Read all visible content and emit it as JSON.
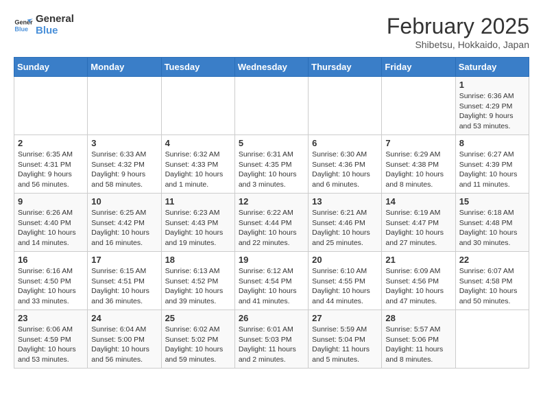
{
  "header": {
    "logo_line1": "General",
    "logo_line2": "Blue",
    "month_year": "February 2025",
    "location": "Shibetsu, Hokkaido, Japan"
  },
  "days_of_week": [
    "Sunday",
    "Monday",
    "Tuesday",
    "Wednesday",
    "Thursday",
    "Friday",
    "Saturday"
  ],
  "weeks": [
    [
      {
        "day": "",
        "info": ""
      },
      {
        "day": "",
        "info": ""
      },
      {
        "day": "",
        "info": ""
      },
      {
        "day": "",
        "info": ""
      },
      {
        "day": "",
        "info": ""
      },
      {
        "day": "",
        "info": ""
      },
      {
        "day": "1",
        "info": "Sunrise: 6:36 AM\nSunset: 4:29 PM\nDaylight: 9 hours and 53 minutes."
      }
    ],
    [
      {
        "day": "2",
        "info": "Sunrise: 6:35 AM\nSunset: 4:31 PM\nDaylight: 9 hours and 56 minutes."
      },
      {
        "day": "3",
        "info": "Sunrise: 6:33 AM\nSunset: 4:32 PM\nDaylight: 9 hours and 58 minutes."
      },
      {
        "day": "4",
        "info": "Sunrise: 6:32 AM\nSunset: 4:33 PM\nDaylight: 10 hours and 1 minute."
      },
      {
        "day": "5",
        "info": "Sunrise: 6:31 AM\nSunset: 4:35 PM\nDaylight: 10 hours and 3 minutes."
      },
      {
        "day": "6",
        "info": "Sunrise: 6:30 AM\nSunset: 4:36 PM\nDaylight: 10 hours and 6 minutes."
      },
      {
        "day": "7",
        "info": "Sunrise: 6:29 AM\nSunset: 4:38 PM\nDaylight: 10 hours and 8 minutes."
      },
      {
        "day": "8",
        "info": "Sunrise: 6:27 AM\nSunset: 4:39 PM\nDaylight: 10 hours and 11 minutes."
      }
    ],
    [
      {
        "day": "9",
        "info": "Sunrise: 6:26 AM\nSunset: 4:40 PM\nDaylight: 10 hours and 14 minutes."
      },
      {
        "day": "10",
        "info": "Sunrise: 6:25 AM\nSunset: 4:42 PM\nDaylight: 10 hours and 16 minutes."
      },
      {
        "day": "11",
        "info": "Sunrise: 6:23 AM\nSunset: 4:43 PM\nDaylight: 10 hours and 19 minutes."
      },
      {
        "day": "12",
        "info": "Sunrise: 6:22 AM\nSunset: 4:44 PM\nDaylight: 10 hours and 22 minutes."
      },
      {
        "day": "13",
        "info": "Sunrise: 6:21 AM\nSunset: 4:46 PM\nDaylight: 10 hours and 25 minutes."
      },
      {
        "day": "14",
        "info": "Sunrise: 6:19 AM\nSunset: 4:47 PM\nDaylight: 10 hours and 27 minutes."
      },
      {
        "day": "15",
        "info": "Sunrise: 6:18 AM\nSunset: 4:48 PM\nDaylight: 10 hours and 30 minutes."
      }
    ],
    [
      {
        "day": "16",
        "info": "Sunrise: 6:16 AM\nSunset: 4:50 PM\nDaylight: 10 hours and 33 minutes."
      },
      {
        "day": "17",
        "info": "Sunrise: 6:15 AM\nSunset: 4:51 PM\nDaylight: 10 hours and 36 minutes."
      },
      {
        "day": "18",
        "info": "Sunrise: 6:13 AM\nSunset: 4:52 PM\nDaylight: 10 hours and 39 minutes."
      },
      {
        "day": "19",
        "info": "Sunrise: 6:12 AM\nSunset: 4:54 PM\nDaylight: 10 hours and 41 minutes."
      },
      {
        "day": "20",
        "info": "Sunrise: 6:10 AM\nSunset: 4:55 PM\nDaylight: 10 hours and 44 minutes."
      },
      {
        "day": "21",
        "info": "Sunrise: 6:09 AM\nSunset: 4:56 PM\nDaylight: 10 hours and 47 minutes."
      },
      {
        "day": "22",
        "info": "Sunrise: 6:07 AM\nSunset: 4:58 PM\nDaylight: 10 hours and 50 minutes."
      }
    ],
    [
      {
        "day": "23",
        "info": "Sunrise: 6:06 AM\nSunset: 4:59 PM\nDaylight: 10 hours and 53 minutes."
      },
      {
        "day": "24",
        "info": "Sunrise: 6:04 AM\nSunset: 5:00 PM\nDaylight: 10 hours and 56 minutes."
      },
      {
        "day": "25",
        "info": "Sunrise: 6:02 AM\nSunset: 5:02 PM\nDaylight: 10 hours and 59 minutes."
      },
      {
        "day": "26",
        "info": "Sunrise: 6:01 AM\nSunset: 5:03 PM\nDaylight: 11 hours and 2 minutes."
      },
      {
        "day": "27",
        "info": "Sunrise: 5:59 AM\nSunset: 5:04 PM\nDaylight: 11 hours and 5 minutes."
      },
      {
        "day": "28",
        "info": "Sunrise: 5:57 AM\nSunset: 5:06 PM\nDaylight: 11 hours and 8 minutes."
      },
      {
        "day": "",
        "info": ""
      }
    ]
  ]
}
